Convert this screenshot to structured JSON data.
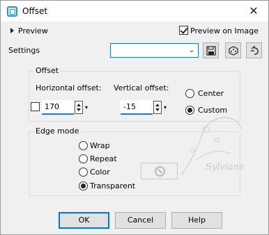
{
  "window": {
    "title": "Offset",
    "close_glyph": "✕"
  },
  "preview": {
    "toggle_label": "Preview",
    "preview_on_image_label": "Preview on Image",
    "preview_on_image_checked": true
  },
  "settings": {
    "label": "Settings",
    "value": ""
  },
  "offset_group": {
    "title": "Offset",
    "horizontal_label": "Horizontal offset:",
    "horizontal_value": "170",
    "vertical_label": "Vertical offset:",
    "vertical_value": "-15",
    "link_checked": false,
    "center_label": "Center",
    "custom_label": "Custom",
    "selected": "Custom"
  },
  "edge_group": {
    "title": "Edge mode",
    "options": [
      "Wrap",
      "Repeat",
      "Color",
      "Transparent"
    ],
    "selected": "Transparent"
  },
  "buttons": {
    "ok": "OK",
    "cancel": "Cancel",
    "help": "Help"
  },
  "watermark": {
    "text": "Sylviane"
  },
  "icons": [
    "offset-app-icon",
    "save-preset-icon",
    "random-dice-icon",
    "reset-icon",
    "no-color-icon"
  ]
}
